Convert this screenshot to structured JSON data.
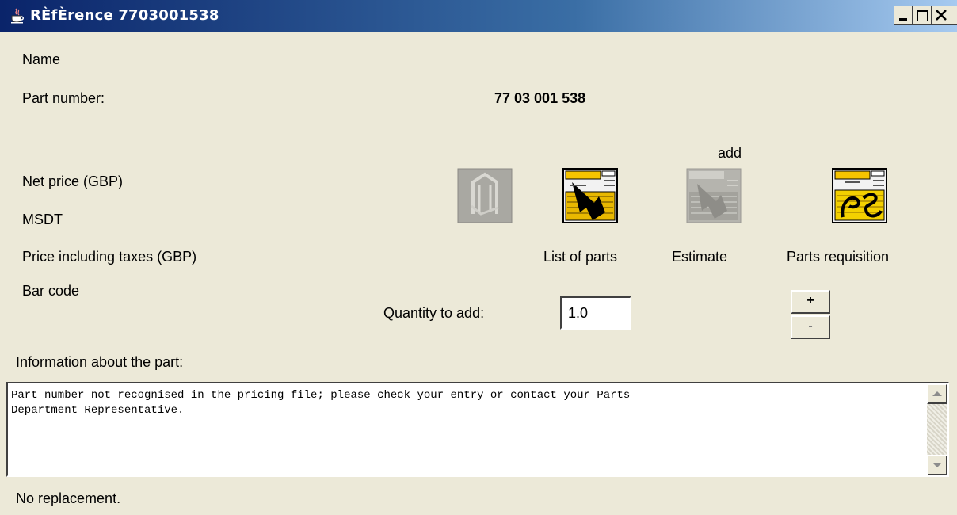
{
  "window": {
    "title": "RÈfÈrence 7703001538",
    "icon": "java-cup-icon"
  },
  "window_controls": {
    "minimize": "minimize-icon",
    "maximize": "maximize-icon",
    "close": "close-icon"
  },
  "labels": {
    "name": "Name",
    "part_number": "Part number:",
    "net_price": "Net price (GBP)",
    "msdt": "MSDT",
    "price_incl_taxes": "Price including taxes (GBP)",
    "bar_code": "Bar code",
    "quantity_to_add": "Quantity to add:",
    "information": "Information about the part:",
    "replacement": "No replacement."
  },
  "values": {
    "part_number": "77 03 001 538"
  },
  "add_label": "add",
  "actions": [
    {
      "id": "part-image",
      "label": "",
      "icon": "part-drawing-icon",
      "enabled": false
    },
    {
      "id": "list-of-parts",
      "label": "List of parts",
      "icon": "parts-list-icon",
      "enabled": true
    },
    {
      "id": "estimate",
      "label": "Estimate",
      "icon": "estimate-icon",
      "enabled": false
    },
    {
      "id": "parts-requisition",
      "label": "Parts requisition",
      "icon": "parts-requisition-icon",
      "enabled": true
    }
  ],
  "quantity": {
    "value": "1.0"
  },
  "stepper": {
    "plus": "+",
    "minus": "-"
  },
  "info_text": "Part number not recognised in the pricing file; please check your entry or contact your Parts\nDepartment Representative."
}
